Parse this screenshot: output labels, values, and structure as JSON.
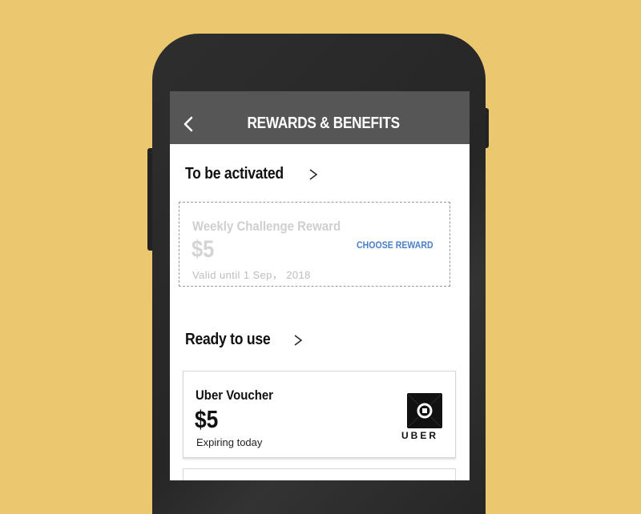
{
  "appbar": {
    "title": "REWARDS & BENEFITS",
    "back_icon": "chevron-left-icon"
  },
  "to_activate": {
    "heading": "To be activated",
    "reward": {
      "title": "Weekly Challenge Reward",
      "amount": "$5",
      "valid": "Valid until 1 Sep， 2018",
      "action": "CHOOSE REWARD"
    }
  },
  "ready": {
    "heading": "Ready to use",
    "voucher": {
      "title": "Uber Voucher",
      "amount": "$5",
      "expiry": "Expiring today",
      "brand": "UBER"
    }
  },
  "colors": {
    "background": "#ebc870",
    "appbar": "#565656",
    "accent": "#4a7fc8"
  }
}
